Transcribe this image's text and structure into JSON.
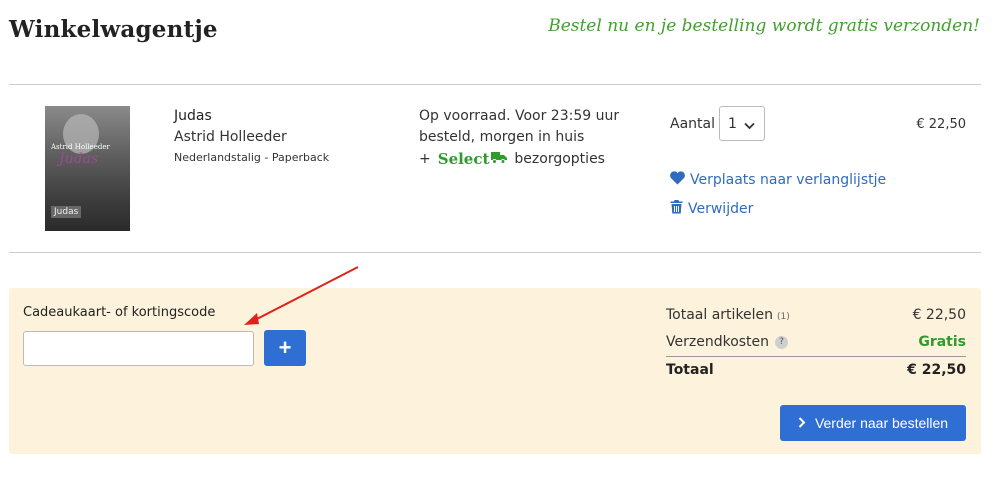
{
  "header": {
    "title": "Winkelwagentje",
    "promo": "Bestel nu en je bestelling wordt gratis verzonden!"
  },
  "item": {
    "cover": {
      "author": "Astrid Holleeder",
      "title": "Judas",
      "label": "Judas"
    },
    "title": "Judas",
    "author": "Astrid Holleeder",
    "meta": "Nederlandstalig - Paperback",
    "stock_line1": "Op voorraad. Voor 23:59 uur",
    "stock_line2": "besteld, morgen in huis",
    "select_plus": "+",
    "select_logo": "Select",
    "select_suffix": "bezorgopties",
    "quantity_label": "Aantal",
    "quantity_value": "1",
    "price": "€ 22,50",
    "wishlist_link": "Verplaats naar verlanglijstje",
    "remove_link": "Verwijder"
  },
  "discount": {
    "label": "Cadeaukaart- of kortingscode",
    "input_value": "",
    "add_button": "+"
  },
  "summary": {
    "items_label": "Totaal artikelen",
    "items_count": "(1)",
    "items_value": "€ 22,50",
    "shipping_label": "Verzendkosten",
    "shipping_help": "?",
    "shipping_value": "Gratis",
    "total_label": "Totaal",
    "total_value": "€ 22,50"
  },
  "checkout": {
    "label": "Verder naar bestellen"
  },
  "colors": {
    "accent_blue": "#2f6fd4",
    "link_blue": "#2f6cbf",
    "promo_green": "#43a030",
    "free_green": "#2e9b2e",
    "panel_bg": "#fdf3dc",
    "arrow_red": "#e0221a"
  },
  "icons": {
    "quantity": "chevron-down-icon",
    "wishlist": "heart-icon",
    "remove": "trash-icon",
    "select": "truck-icon",
    "help": "question-icon",
    "checkout": "chevron-right-icon"
  }
}
